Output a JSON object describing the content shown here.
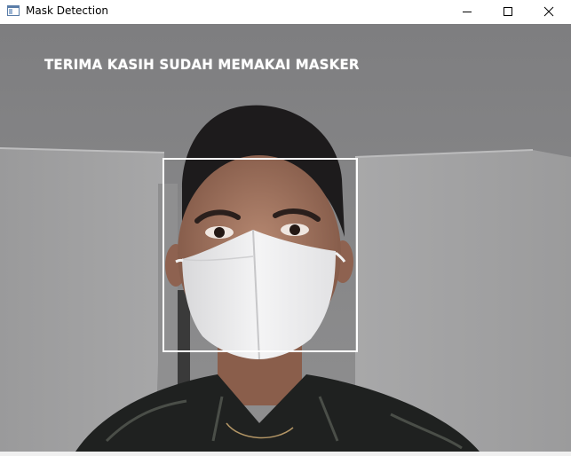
{
  "window": {
    "title": "Mask Detection",
    "controls": {
      "minimize_icon": "minimize-icon",
      "maximize_icon": "maximize-icon",
      "close_icon": "close-icon"
    }
  },
  "video": {
    "overlay_text": "TERIMA KASIH SUDAH MEMAKAI MASKER",
    "overlay_color": "#ffffff",
    "detection_box_color": "#ffffff"
  }
}
